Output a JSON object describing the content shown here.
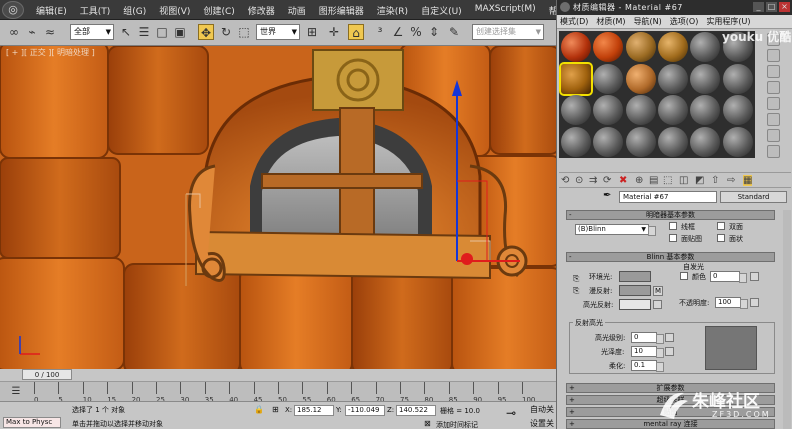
{
  "menubar": {
    "items": [
      "编辑(E)",
      "工具(T)",
      "组(G)",
      "视图(V)",
      "创建(C)",
      "修改器",
      "动画",
      "图形编辑器",
      "渲染(R)",
      "自定义(U)",
      "MAXScript(M)",
      "帮助(H)"
    ]
  },
  "toolbar": {
    "filter_value": "全部",
    "coord_system": "世界",
    "named_selection_placeholder": "创建选择集"
  },
  "viewport": {
    "label": "[ + ][ 正交 ][ 明暗处理 ]",
    "frame_counter": "0 / 100"
  },
  "timeline": {
    "ticks": [
      "0",
      "5",
      "10",
      "15",
      "20",
      "25",
      "30",
      "35",
      "40",
      "45",
      "50",
      "55",
      "60",
      "65",
      "70",
      "75",
      "80",
      "85",
      "90",
      "95",
      "100"
    ]
  },
  "statusbar": {
    "maxscript_label": "Max to Physc",
    "selection_status": "选择了 1 个 对象",
    "prompt": "单击并拖动以选择并移动对象",
    "x_label": "X:",
    "x_value": "185.12",
    "y_label": "Y:",
    "y_value": "-110.049",
    "z_label": "Z:",
    "z_value": "140.522",
    "grid_label": "栅格 = 10.0",
    "auto_key": "自动关",
    "set_key": "设置关",
    "add_time_tag": "添加时间标记"
  },
  "material_editor": {
    "title": "材质编辑器 - Material #67",
    "menu": [
      "模式(D)",
      "材质(M)",
      "导航(N)",
      "选项(O)",
      "实用程序(U)"
    ],
    "material_name": "Material #67",
    "material_type": "Standard",
    "rollout_shader_basic": "明暗器基本参数",
    "shader_value": "(B)Blinn",
    "shader_options": [
      "线框",
      "双面",
      "面贴图",
      "面状"
    ],
    "rollout_blinn_basic": "Blinn 基本参数",
    "self_illum_label": "自发光",
    "color_label": "颜色",
    "color_value": "0",
    "ambient_label": "环境光:",
    "diffuse_label": "漫反射:",
    "specular_label": "高光反射:",
    "opacity_label": "不透明度:",
    "opacity_value": "100",
    "spec_highlights_label": "反射高光",
    "spec_level_label": "高光级别:",
    "spec_level_value": "0",
    "glossiness_label": "光泽度:",
    "glossiness_value": "10",
    "soften_label": "柔化:",
    "soften_value": "0.1",
    "rollout_extended": "扩展参数",
    "rollout_supersampling": "超级采样",
    "rollout_maps": "贴图",
    "rollout_mental_ray": "mental ray 连接"
  },
  "overlays": {
    "youku": "youku 优酷",
    "watermark_main": "朱峰社区",
    "watermark_sub": "ZF3D.COM"
  },
  "colors": {
    "wood_orange": "#d8701f",
    "slot_selected": "#f3e000",
    "gizmo_red": "#e01c1c",
    "gizmo_blue": "#1535d8"
  }
}
